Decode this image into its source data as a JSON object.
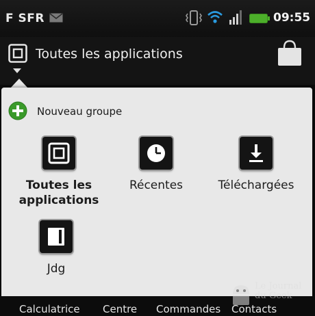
{
  "statusbar": {
    "carrier": "F SFR",
    "time": "09:55",
    "icons": [
      "mail-icon",
      "vibrate-icon",
      "wifi-icon",
      "signal-icon",
      "battery-icon"
    ],
    "battery_color": "#4caf2a"
  },
  "header": {
    "title": "Toutes les applications"
  },
  "panel": {
    "new_group_label": "Nouveau groupe",
    "tiles": [
      {
        "label_line1": "Toutes les",
        "label_line2": "applications",
        "icon": "all-apps-icon",
        "selected": true
      },
      {
        "label_line1": "Récentes",
        "icon": "clock-icon"
      },
      {
        "label_line1": "Téléchargées",
        "icon": "download-icon"
      },
      {
        "label_line1": "Jdg",
        "icon": "folder-icon"
      }
    ]
  },
  "dock": {
    "items": [
      "Calculatrice",
      "Centre",
      "Commandes",
      "Contacts"
    ]
  },
  "watermark": {
    "line1": "Le Journal",
    "line2": "du Geek"
  },
  "colors": {
    "accent_green": "#3a9a2a",
    "panel_bg": "#e8e8e8",
    "background": "#0c0c0c"
  }
}
